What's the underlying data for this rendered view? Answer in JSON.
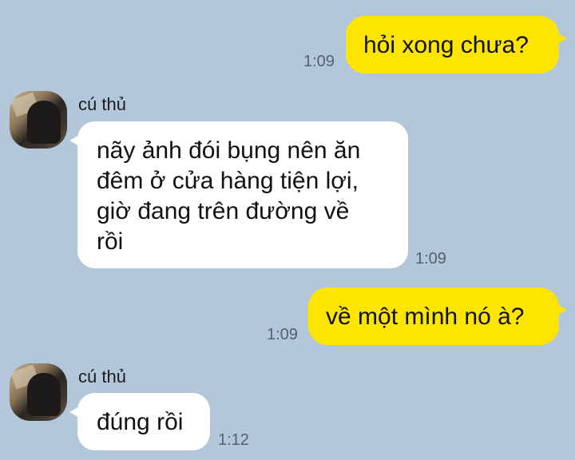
{
  "messages": [
    {
      "direction": "outgoing",
      "text": "hỏi xong chưa?",
      "time": "1:09"
    },
    {
      "direction": "incoming",
      "sender": "cú thủ",
      "text": "nãy ảnh đói bụng nên ăn\nđêm ở cửa hàng tiện lợi,\ngiờ đang trên đường về\nrồi",
      "time": "1:09"
    },
    {
      "direction": "outgoing",
      "text": "về một mình nó à?",
      "time": "1:09"
    },
    {
      "direction": "incoming",
      "sender": "cú thủ",
      "text": "đúng rồi",
      "time": "1:12"
    }
  ],
  "colors": {
    "background": "#b2c7da",
    "outgoing_bubble": "#fee500",
    "incoming_bubble": "#ffffff"
  }
}
